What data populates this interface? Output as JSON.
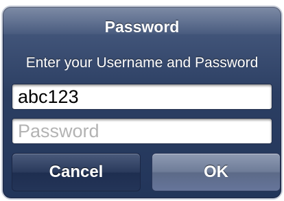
{
  "dialog": {
    "title": "Password",
    "message": "Enter your Username and Password",
    "username_value": "abc123",
    "password_placeholder": "Password",
    "cancel_label": "Cancel",
    "ok_label": "OK"
  },
  "colors": {
    "dialog_background": "#2c3f63",
    "dialog_border": "#c9cfdb",
    "text": "#ffffff",
    "placeholder": "#b3b3b3"
  }
}
